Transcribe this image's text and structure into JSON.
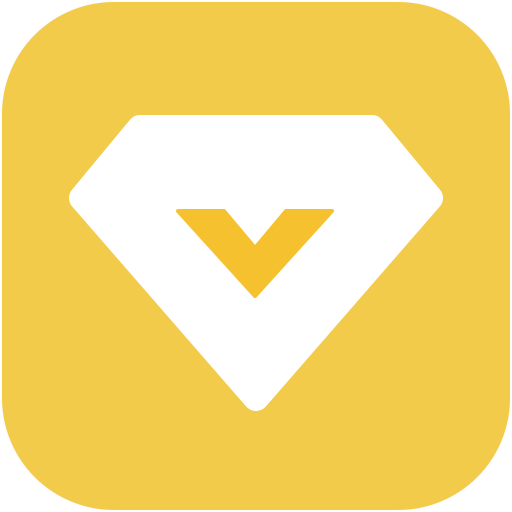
{
  "app_icon": {
    "icon": "diamond-v-logo-icon",
    "colors": {
      "background": "#F3CB4B",
      "diamond": "#FFFFFF",
      "chevron": "#F5C12E"
    }
  }
}
